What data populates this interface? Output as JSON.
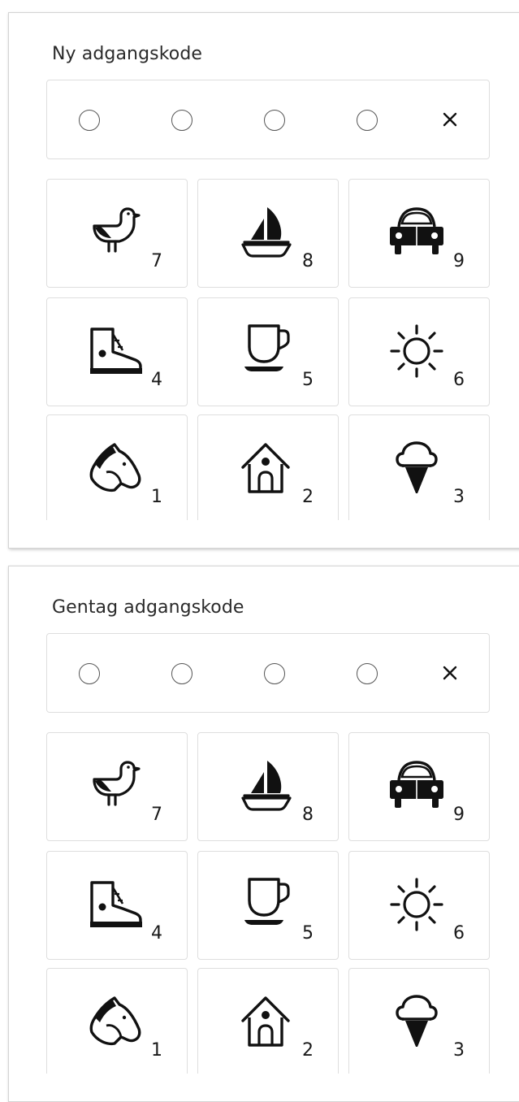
{
  "panels": [
    {
      "title": "Ny adgangskode",
      "clear_symbol": "×",
      "slots": [
        "",
        "",
        "",
        ""
      ],
      "keys": [
        {
          "digit": "7",
          "icon": "bird-icon"
        },
        {
          "digit": "8",
          "icon": "sailboat-icon"
        },
        {
          "digit": "9",
          "icon": "car-icon"
        },
        {
          "digit": "4",
          "icon": "sneaker-icon"
        },
        {
          "digit": "5",
          "icon": "cup-icon"
        },
        {
          "digit": "6",
          "icon": "sun-icon"
        },
        {
          "digit": "1",
          "icon": "horse-head-icon"
        },
        {
          "digit": "2",
          "icon": "birdhouse-icon"
        },
        {
          "digit": "3",
          "icon": "ice-cream-icon"
        }
      ]
    },
    {
      "title": "Gentag adgangskode",
      "clear_symbol": "×",
      "slots": [
        "",
        "",
        "",
        ""
      ],
      "keys": [
        {
          "digit": "7",
          "icon": "bird-icon"
        },
        {
          "digit": "8",
          "icon": "sailboat-icon"
        },
        {
          "digit": "9",
          "icon": "car-icon"
        },
        {
          "digit": "4",
          "icon": "sneaker-icon"
        },
        {
          "digit": "5",
          "icon": "cup-icon"
        },
        {
          "digit": "6",
          "icon": "sun-icon"
        },
        {
          "digit": "1",
          "icon": "horse-head-icon"
        },
        {
          "digit": "2",
          "icon": "birdhouse-icon"
        },
        {
          "digit": "3",
          "icon": "ice-cream-icon"
        }
      ]
    }
  ]
}
